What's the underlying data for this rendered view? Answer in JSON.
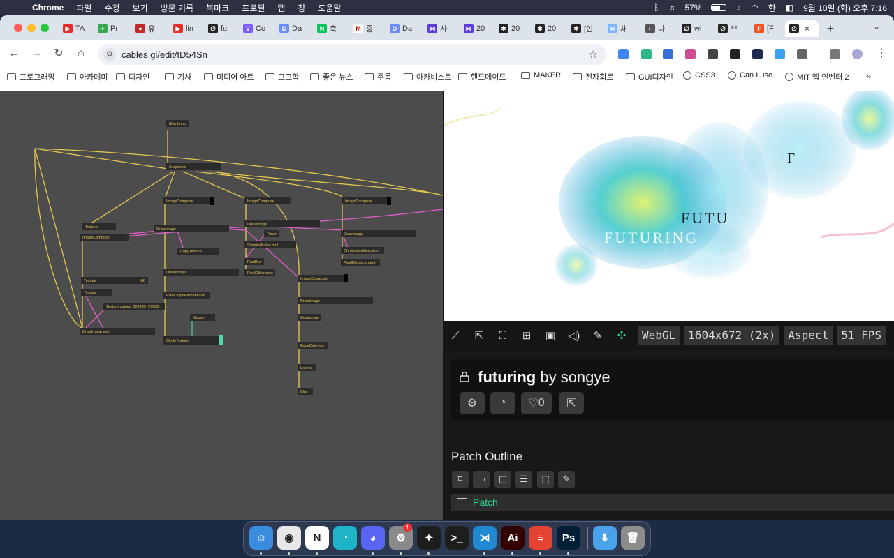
{
  "menubar": {
    "app_name": "Chrome",
    "menus": [
      "파일",
      "수정",
      "보기",
      "방문 기록",
      "북마크",
      "프로필",
      "탭",
      "창",
      "도움말"
    ],
    "battery": "57%",
    "korean_ime": "한",
    "datetime": "9월 10일 (화) 오후 7:16"
  },
  "tabs": [
    {
      "label": "TA",
      "color": "#e52d27",
      "glyph": "▶"
    },
    {
      "label": "Pr",
      "color": "#34a853",
      "glyph": "+"
    },
    {
      "label": "유",
      "color": "#c62828",
      "glyph": "●"
    },
    {
      "label": "lin",
      "color": "#e52d27",
      "glyph": "▶"
    },
    {
      "label": "fu",
      "color": "#222222",
      "glyph": "∅"
    },
    {
      "label": "Cc",
      "color": "#7c5cff",
      "glyph": "V"
    },
    {
      "label": "Da",
      "color": "#6a8cff",
      "glyph": "D"
    },
    {
      "label": "축",
      "color": "#03c75a",
      "glyph": "N"
    },
    {
      "label": "중",
      "color": "#ffffff",
      "glyph": "M"
    },
    {
      "label": "Da",
      "color": "#6a8cff",
      "glyph": "D"
    },
    {
      "label": "사",
      "color": "#5b3fd6",
      "glyph": "⋈"
    },
    {
      "label": "20",
      "color": "#5b3fd6",
      "glyph": "⋈"
    },
    {
      "label": "20",
      "color": "#222222",
      "glyph": "✱"
    },
    {
      "label": "20",
      "color": "#222222",
      "glyph": "✱"
    },
    {
      "label": "[인",
      "color": "#222222",
      "glyph": "✱"
    },
    {
      "label": "새",
      "color": "#7fb5ff",
      "glyph": "✉"
    },
    {
      "label": "나",
      "color": "#555555",
      "glyph": "◐"
    },
    {
      "label": "wi",
      "color": "#222222",
      "glyph": "∅"
    },
    {
      "label": "브",
      "color": "#222222",
      "glyph": "∅"
    },
    {
      "label": "[F",
      "color": "#f24e1e",
      "glyph": "F"
    },
    {
      "label": "",
      "color": "#222222",
      "glyph": "∅",
      "active": true
    }
  ],
  "omnibox": {
    "url": "cables.gl/edit/tD54Sn"
  },
  "bookmarks": [
    {
      "label": "프로그래밍",
      "type": "folder"
    },
    {
      "label": "아카데미",
      "type": "folder"
    },
    {
      "label": "디자인",
      "type": "folder"
    },
    {
      "label": "기사",
      "type": "folder"
    },
    {
      "label": "미디어 아트",
      "type": "folder"
    },
    {
      "label": "고고학",
      "type": "folder"
    },
    {
      "label": "좋은 뉴스",
      "type": "folder"
    },
    {
      "label": "주목",
      "type": "folder"
    },
    {
      "label": "아카비스트",
      "type": "folder"
    },
    {
      "label": "핸드메이드",
      "type": "folder"
    },
    {
      "label": "MAKER",
      "type": "folder"
    },
    {
      "label": "전자회로",
      "type": "folder"
    },
    {
      "label": "GUI디자인",
      "type": "folder"
    },
    {
      "label": "CSS3",
      "type": "globe"
    },
    {
      "label": "Can I use",
      "type": "globe"
    },
    {
      "label": "MIT 앱 인벤터 2",
      "type": "globe"
    }
  ],
  "patch_nodes": {
    "mainloop": "MainLoop",
    "sequence": "Sequence",
    "imagecompose_1": "ImageCompose",
    "imagecompose_2": "ImageCompose",
    "imagecompose_3": "ImageCompose",
    "imagecompose_4": "ImageCompose",
    "imagecompose_5": "ImageCompose",
    "texture_1": "Texture",
    "texture_2": "Texture",
    "texture_3": "Texture",
    "texture_4": "Texture cables_302489_97088",
    "drawimage_1": "DrawImage",
    "drawimage_2": "DrawImage",
    "drawimage_3": "DrawImage",
    "drawimage_4": "DrawImage",
    "drawimage_5": "DrawImage",
    "drawimage_6": "DrawImage mul",
    "copytexture": "CopyTexture",
    "timer": "Timer",
    "simplexnoise": "SimplexNoise mul",
    "pastblur": "PastBlur",
    "pixeldifference": "PixelDifference",
    "chromaticaberration": "ChromaticAberration",
    "pixeldisplacement_1": "PixelDisplacement",
    "pixeldisplacement_2": "PixelDisplacement sub",
    "mouse": "Mouse",
    "circletexture": "CircleTexture",
    "desaturate": "Desaturate",
    "edgedetection": "EdgeDetection",
    "levels": "Levels",
    "blur": "Blur",
    "texture_value": "-86"
  },
  "preview": {
    "text_1": "FUTU",
    "text_2": "FUTURING",
    "text_3": "F"
  },
  "canvas_toolbar": {
    "renderer": "WebGL",
    "resolution": "1604x672 (2x)",
    "aspect": "Aspect",
    "fps": "51 FPS"
  },
  "project": {
    "name": "futuring",
    "by_label": "by songye",
    "like_count": "0"
  },
  "outline": {
    "title": "Patch Outline",
    "root_item": "Patch"
  },
  "dock": [
    {
      "name": "finder",
      "color": "#3a8dde",
      "glyph": "☺"
    },
    {
      "name": "chrome",
      "color": "#e8e8e8",
      "glyph": "◉"
    },
    {
      "name": "notion",
      "color": "#ffffff",
      "glyph": "N"
    },
    {
      "name": "mascot",
      "color": "#1fb5c9",
      "glyph": "◔"
    },
    {
      "name": "discord",
      "color": "#5865f2",
      "glyph": "◕"
    },
    {
      "name": "settings",
      "color": "#8a8a8a",
      "glyph": "⚙"
    },
    {
      "name": "figma",
      "color": "#1e1e1e",
      "glyph": "✦"
    },
    {
      "name": "terminal",
      "color": "#1e1e1e",
      "glyph": ">_"
    },
    {
      "name": "vscode",
      "color": "#1f8ad2",
      "glyph": "⋊"
    },
    {
      "name": "illustrator",
      "color": "#330000",
      "glyph": "Ai"
    },
    {
      "name": "todoist",
      "color": "#e44332",
      "glyph": "≡"
    },
    {
      "name": "photoshop",
      "color": "#001e36",
      "glyph": "Ps"
    },
    {
      "name": "downloads",
      "color": "#4aa3e8",
      "glyph": "⬇"
    },
    {
      "name": "trash",
      "color": "#8c8c8c",
      "glyph": "🗑"
    }
  ],
  "dock_badge": "1"
}
